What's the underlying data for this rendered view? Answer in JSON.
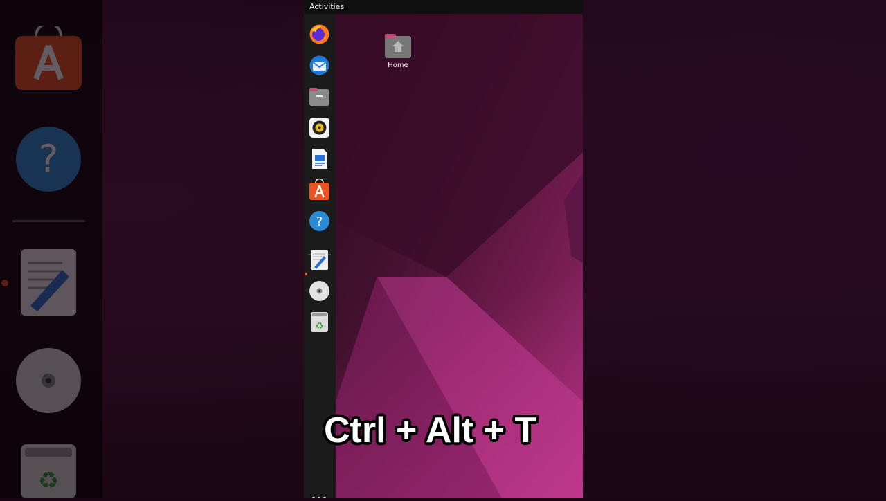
{
  "topbar": {
    "activities": "Activities"
  },
  "desktop": {
    "home_label": "Home"
  },
  "dock": {
    "items": [
      {
        "name": "Firefox",
        "icon": "firefox-icon"
      },
      {
        "name": "Thunderbird",
        "icon": "thunderbird-icon"
      },
      {
        "name": "Files",
        "icon": "files-icon"
      },
      {
        "name": "Rhythmbox",
        "icon": "rhythmbox-icon"
      },
      {
        "name": "LibreOffice Writer",
        "icon": "writer-icon"
      },
      {
        "name": "Ubuntu Software",
        "icon": "software-store-icon"
      },
      {
        "name": "Help",
        "icon": "help-icon"
      },
      {
        "name": "Text Editor",
        "icon": "text-editor-icon"
      },
      {
        "name": "Disc",
        "icon": "disc-icon"
      },
      {
        "name": "Trash",
        "icon": "trash-icon"
      }
    ],
    "show_apps": "show-applications-icon"
  },
  "overlay": {
    "shortcut": "Ctrl + Alt + T"
  },
  "colors": {
    "accent": "#e95420",
    "dock": "#1b1b1b",
    "topbar": "#101010"
  }
}
